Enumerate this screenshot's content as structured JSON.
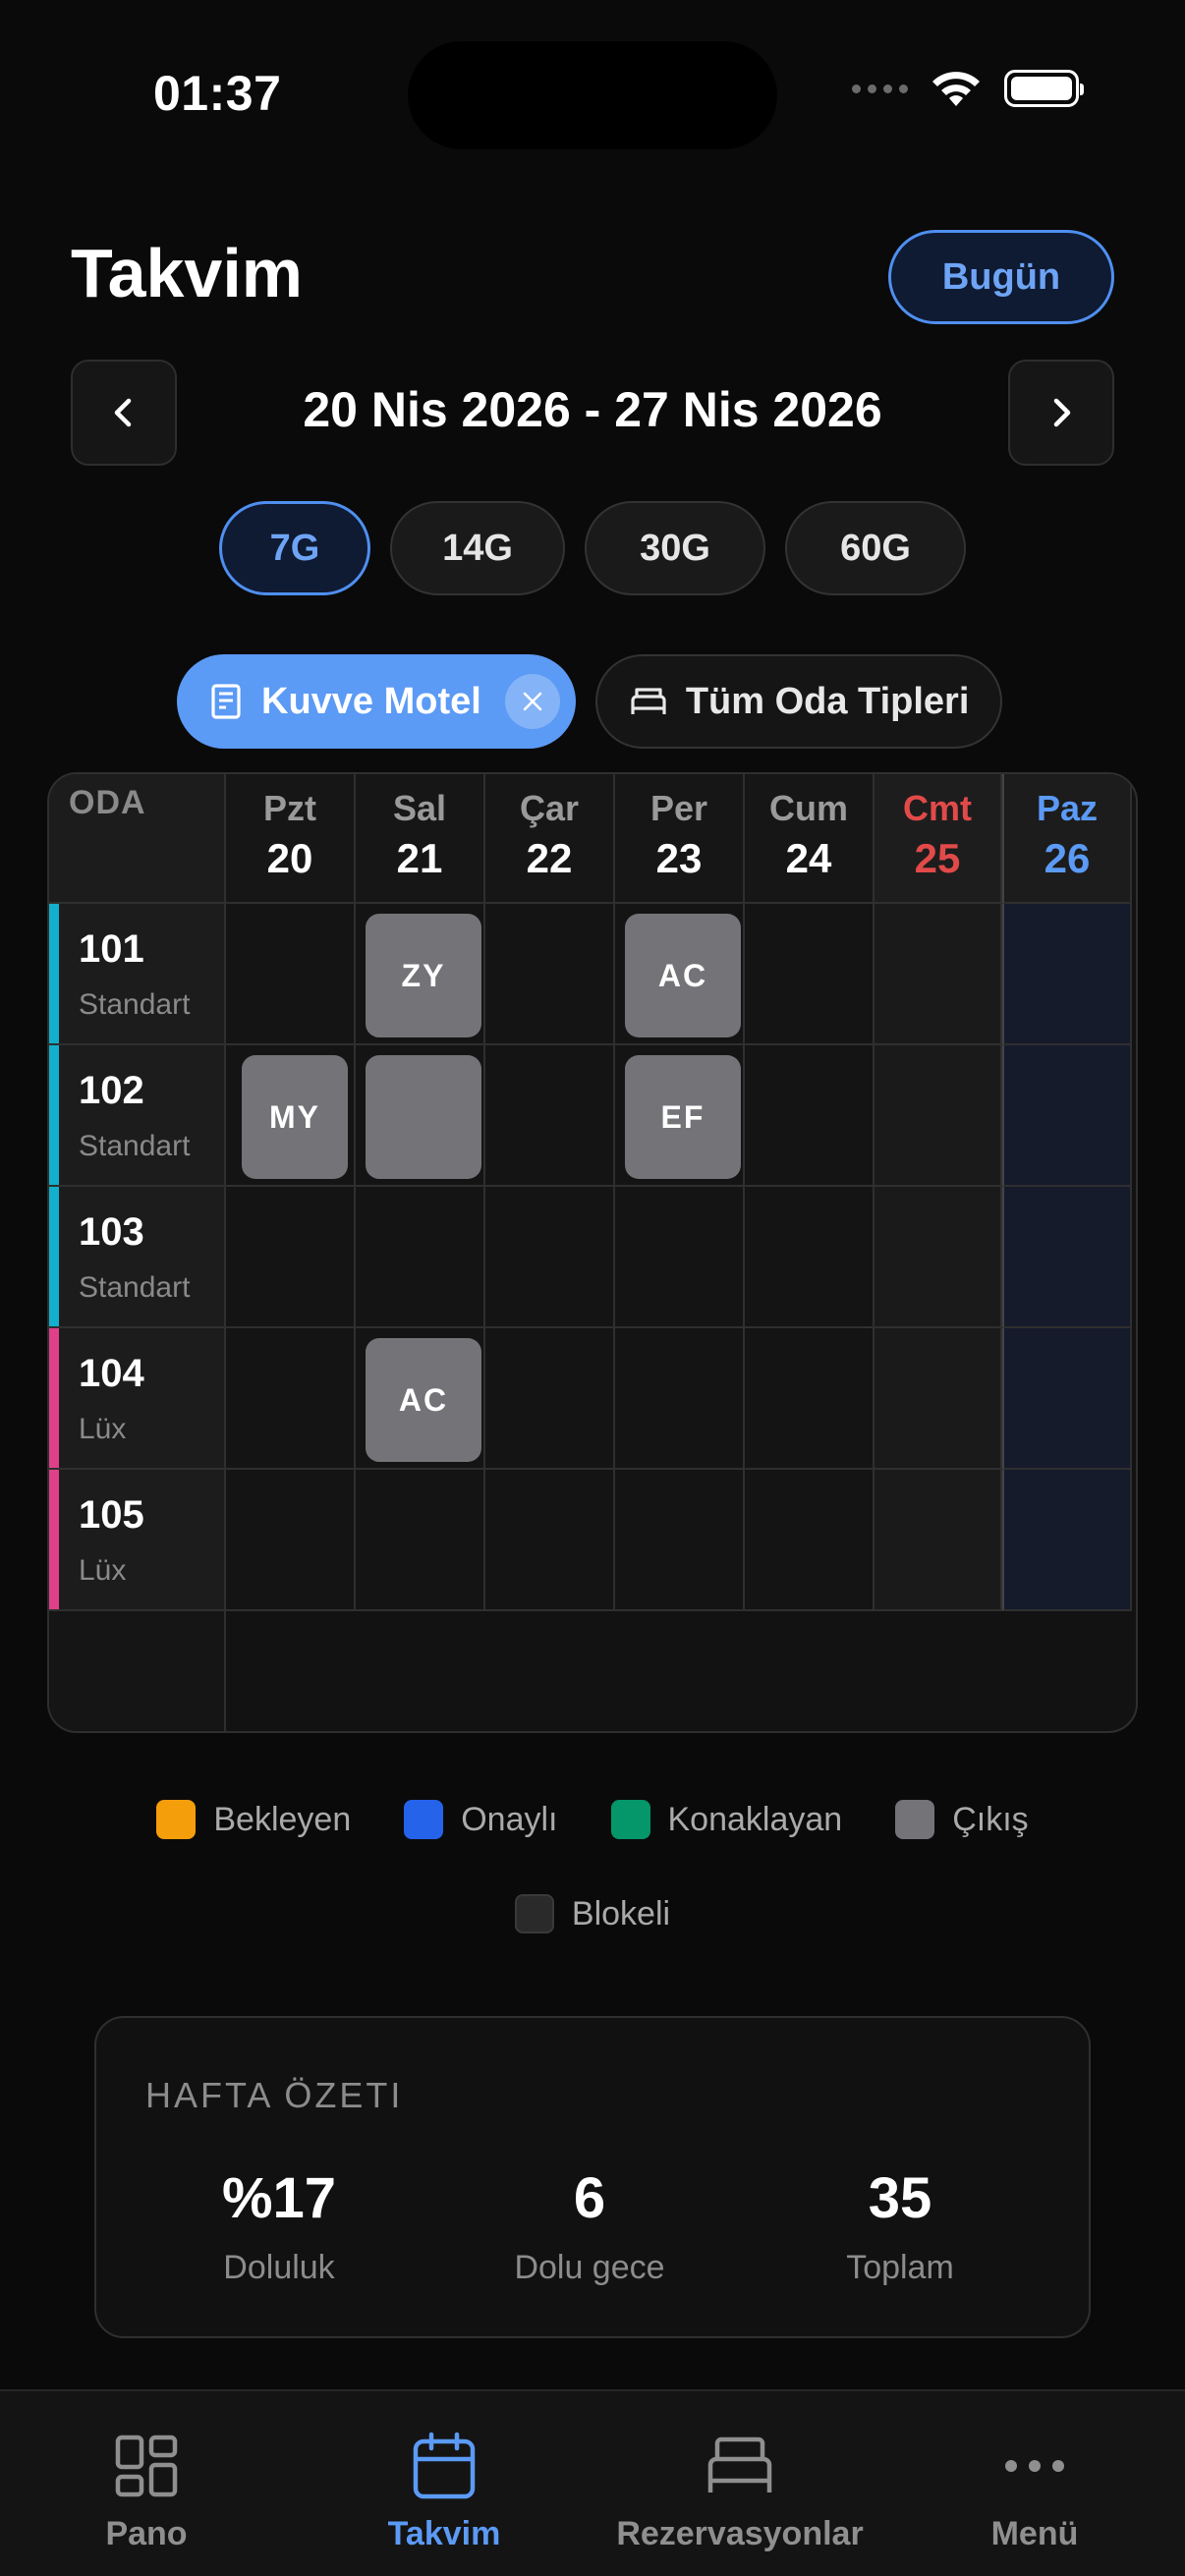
{
  "status_bar": {
    "time": "01:37"
  },
  "header": {
    "title": "Takvim",
    "today_label": "Bugün"
  },
  "date_nav": {
    "range": "20 Nis 2026 - 27 Nis 2026"
  },
  "range_options": [
    "7G",
    "14G",
    "30G",
    "60G"
  ],
  "range_selected": "7G",
  "filters": {
    "hotel": "Kuvve Motel",
    "room_types": "Tüm Oda Tipleri"
  },
  "grid": {
    "room_header": "ODA",
    "days": [
      {
        "name": "Pzt",
        "num": "20"
      },
      {
        "name": "Sal",
        "num": "21"
      },
      {
        "name": "Çar",
        "num": "22"
      },
      {
        "name": "Per",
        "num": "23"
      },
      {
        "name": "Cum",
        "num": "24"
      },
      {
        "name": "Cmt",
        "num": "25"
      },
      {
        "name": "Paz",
        "num": "26"
      }
    ],
    "rooms": [
      {
        "number": "101",
        "type": "Standart",
        "color": "#12b0cc"
      },
      {
        "number": "102",
        "type": "Standart",
        "color": "#12b0cc"
      },
      {
        "number": "103",
        "type": "Standart",
        "color": "#12b0cc"
      },
      {
        "number": "104",
        "type": "Lüx",
        "color": "#e0408a"
      },
      {
        "number": "105",
        "type": "Lüx",
        "color": "#e0408a"
      }
    ],
    "bookings": [
      {
        "room": 0,
        "day": 1,
        "label": "ZY"
      },
      {
        "room": 0,
        "day": 3,
        "label": "AC"
      },
      {
        "room": 1,
        "day": 0,
        "label": "MY"
      },
      {
        "room": 1,
        "day": 1,
        "label": ""
      },
      {
        "room": 1,
        "day": 3,
        "label": "EF"
      },
      {
        "room": 3,
        "day": 1,
        "label": "AC"
      }
    ]
  },
  "legend": [
    {
      "label": "Bekleyen",
      "color": "#f59e0b"
    },
    {
      "label": "Onaylı",
      "color": "#2563eb"
    },
    {
      "label": "Konaklayan",
      "color": "#059669"
    },
    {
      "label": "Çıkış",
      "color": "#737378"
    },
    {
      "label": "Blokeli",
      "color": "#2a2a2a"
    }
  ],
  "summary": {
    "title": "HAFTA ÖZETI",
    "stats": [
      {
        "value": "%17",
        "label": "Doluluk"
      },
      {
        "value": "6",
        "label": "Dolu gece"
      },
      {
        "value": "35",
        "label": "Toplam"
      }
    ]
  },
  "tabs": [
    {
      "label": "Pano",
      "icon": "dashboard-icon"
    },
    {
      "label": "Takvim",
      "icon": "calendar-icon"
    },
    {
      "label": "Rezervasyonlar",
      "icon": "bed-icon"
    },
    {
      "label": "Menü",
      "icon": "more-icon"
    }
  ],
  "active_tab": "Takvim"
}
